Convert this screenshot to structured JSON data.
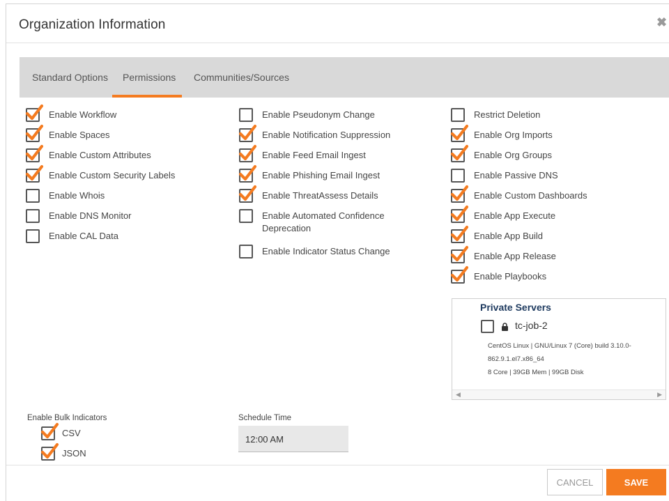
{
  "dialog": {
    "title": "Organization Information",
    "close_glyph": "✖"
  },
  "tabs": [
    {
      "label": "Standard Options",
      "active": false
    },
    {
      "label": "Permissions",
      "active": true
    },
    {
      "label": "Communities/Sources",
      "active": false
    }
  ],
  "permissions": {
    "col1": [
      {
        "label": "Enable Workflow",
        "checked": true
      },
      {
        "label": "Enable Spaces",
        "checked": true
      },
      {
        "label": "Enable Custom Attributes",
        "checked": true
      },
      {
        "label": "Enable Custom Security Labels",
        "checked": true
      },
      {
        "label": "Enable Whois",
        "checked": false
      },
      {
        "label": "Enable DNS Monitor",
        "checked": false
      },
      {
        "label": "Enable CAL Data",
        "checked": false
      }
    ],
    "col2": [
      {
        "label": "Enable Pseudonym Change",
        "checked": false
      },
      {
        "label": "Enable Notification Suppression",
        "checked": true
      },
      {
        "label": "Enable Feed Email Ingest",
        "checked": true
      },
      {
        "label": "Enable Phishing Email Ingest",
        "checked": true
      },
      {
        "label": "Enable ThreatAssess Details",
        "checked": true
      },
      {
        "label": "Enable Automated Confidence Deprecation",
        "checked": false
      },
      {
        "label": "Enable Indicator Status Change",
        "checked": false
      }
    ],
    "col3": [
      {
        "label": "Restrict Deletion",
        "checked": false
      },
      {
        "label": "Enable Org Imports",
        "checked": true
      },
      {
        "label": "Enable Org Groups",
        "checked": true
      },
      {
        "label": "Enable Passive DNS",
        "checked": false
      },
      {
        "label": "Enable Custom Dashboards",
        "checked": true
      },
      {
        "label": "Enable App Execute",
        "checked": true
      },
      {
        "label": "Enable App Build",
        "checked": true
      },
      {
        "label": "Enable App Release",
        "checked": true
      },
      {
        "label": "Enable Playbooks",
        "checked": true
      }
    ]
  },
  "private_servers": {
    "title": "Private Servers",
    "server": {
      "name": "tc-job-2",
      "checked": false,
      "os": "CentOS Linux | GNU/Linux 7 (Core) build 3.10.0-862.9.1.el7.x86_64",
      "specs": "8 Core | 39GB Mem | 99GB Disk"
    },
    "scroll_left": "◀",
    "scroll_right": "▶"
  },
  "bulk": {
    "label": "Enable Bulk Indicators",
    "items": [
      {
        "label": "CSV",
        "checked": true
      },
      {
        "label": "JSON",
        "checked": true
      }
    ]
  },
  "schedule": {
    "label": "Schedule Time",
    "value": "12:00 AM"
  },
  "footer": {
    "cancel_label": "CANCEL",
    "save_label": "SAVE"
  },
  "colors": {
    "accent": "#f47b20",
    "tab_bar": "#d9d9d9",
    "checkbox_border": "#555555",
    "server_title": "#1e3a5f"
  },
  "icons": {
    "check": "check-icon",
    "lock": "lock-icon",
    "close": "close-icon"
  }
}
